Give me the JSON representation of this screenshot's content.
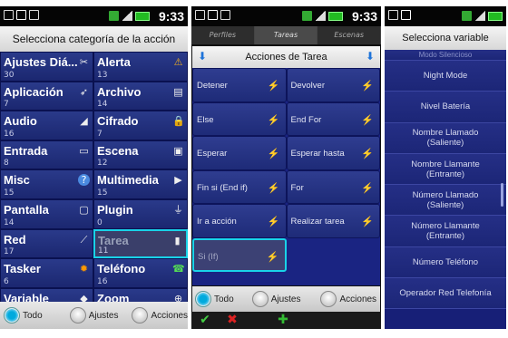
{
  "status": {
    "time": "9:33"
  },
  "screen1": {
    "title": "Selecciona categoría de la acción",
    "categories": [
      {
        "name": "Ajustes Diá...",
        "count": "30",
        "icon": "tools-icon"
      },
      {
        "name": "Alerta",
        "count": "13",
        "icon": "warning-icon"
      },
      {
        "name": "Aplicación",
        "count": "7",
        "icon": "rocket-icon"
      },
      {
        "name": "Archivo",
        "count": "14",
        "icon": "file-icon"
      },
      {
        "name": "Audio",
        "count": "16",
        "icon": "volume-icon"
      },
      {
        "name": "Cifrado",
        "count": "7",
        "icon": "lock-icon"
      },
      {
        "name": "Entrada",
        "count": "8",
        "icon": "keyboard-icon"
      },
      {
        "name": "Escena",
        "count": "12",
        "icon": "scene-icon"
      },
      {
        "name": "Misc",
        "count": "15",
        "icon": "help-icon"
      },
      {
        "name": "Multimedia",
        "count": "15",
        "icon": "media-icon"
      },
      {
        "name": "Pantalla",
        "count": "14",
        "icon": "monitor-icon"
      },
      {
        "name": "Plugin",
        "count": "0",
        "icon": "plug-icon"
      },
      {
        "name": "Red",
        "count": "17",
        "icon": "network-icon"
      },
      {
        "name": "Tarea",
        "count": "11",
        "icon": "task-icon",
        "selected": true
      },
      {
        "name": "Tasker",
        "count": "6",
        "icon": "tasker-icon"
      },
      {
        "name": "Teléfono",
        "count": "16",
        "icon": "phone-icon"
      },
      {
        "name": "Variable",
        "count": "",
        "icon": "variable-icon"
      },
      {
        "name": "Zoom",
        "count": "",
        "icon": "zoom-icon"
      }
    ],
    "bottom": {
      "all": "Todo",
      "settings": "Ajustes",
      "actions": "Acciones",
      "selected": "all"
    }
  },
  "screen2": {
    "tabs": [
      "Perfiles",
      "Tareas",
      "Escenas"
    ],
    "active_tab": "Tareas",
    "title": "Acciones de Tarea",
    "actions": [
      "Detener",
      "Devolver",
      "Else",
      "End For",
      "Esperar",
      "Esperar hasta",
      "Fin si (End if)",
      "For",
      "Ir a acción",
      "Realizar tarea",
      "Si (If)"
    ],
    "selected_action": "Si (If)",
    "bottom": {
      "all": "Todo",
      "settings": "Ajustes",
      "actions": "Acciones",
      "selected": "all"
    }
  },
  "screen3": {
    "title": "Selecciona variable",
    "partial_top": "Modo Silencioso",
    "variables": [
      "Night Mode",
      "Nivel Batería",
      "Nombre Llamado\n(Saliente)",
      "Nombre Llamante\n(Entrante)",
      "Número Llamado\n(Saliente)",
      "Número Llamante\n(Entrante)",
      "Número Teléfono",
      "Operador Red Telefonía"
    ]
  }
}
